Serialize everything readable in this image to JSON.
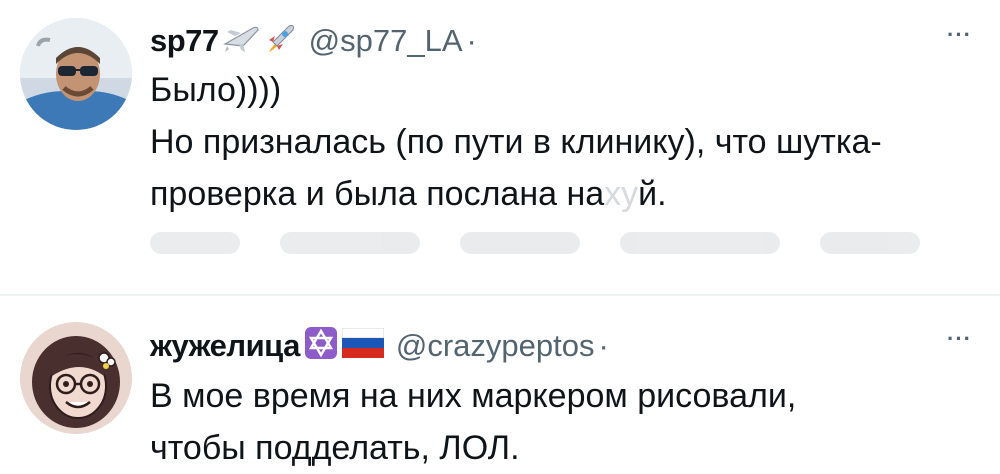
{
  "tweets": [
    {
      "display_name": "sp77",
      "name_emojis": [
        "airplane",
        "rocket"
      ],
      "handle": "@sp77_LA",
      "separator": "·",
      "more_label": "···",
      "lines": [
        "Было))))",
        "Но призналась (по пути в клинику), что шутка-",
        "проверка и была послана на",
        "й."
      ],
      "obscured_fragment": "ху"
    },
    {
      "display_name": "жужелица",
      "name_emojis": [
        "star-of-david",
        "russia-flag"
      ],
      "handle": "@crazypeptos",
      "separator": "·",
      "more_label": "···",
      "lines": [
        "В мое время на них маркером рисовали,",
        "чтобы подделать, ЛОЛ."
      ]
    }
  ],
  "colors": {
    "text": "#0f1419",
    "secondary": "#536471",
    "divider": "#eff3f4",
    "star_badge": "#8e5cc8",
    "flag_white": "#ffffff",
    "flag_blue": "#1c57b8",
    "flag_red": "#d52b1e"
  }
}
